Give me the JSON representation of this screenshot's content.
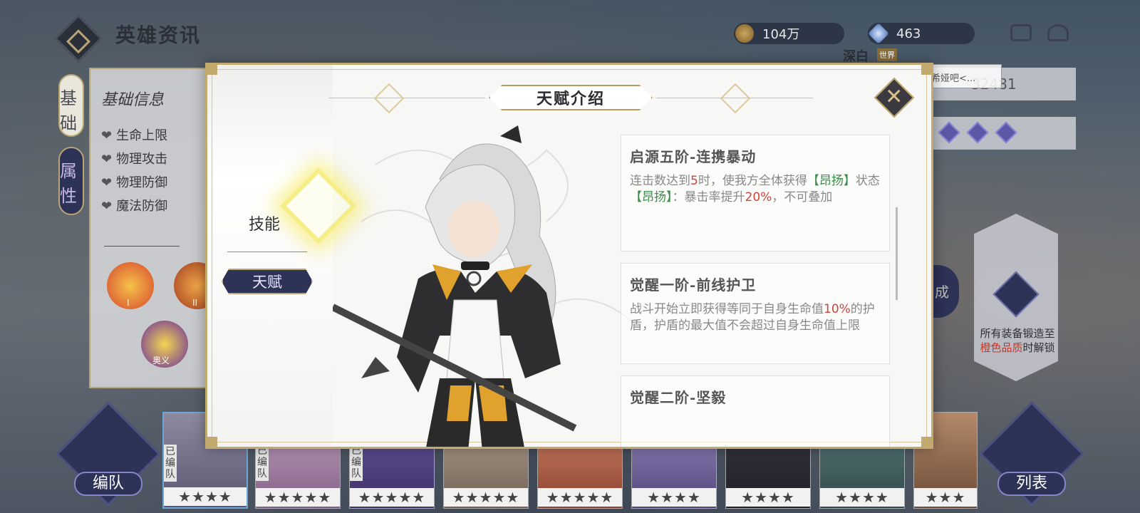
{
  "header": {
    "title": "英雄资讯",
    "gold": "104万",
    "gems": "463"
  },
  "chat": {
    "user": "深白",
    "channel": "世界",
    "message": "希娅吧<..."
  },
  "hero_id": "32481",
  "left_panel": {
    "tab_basic": "基础",
    "tab_attr": "属性",
    "heading": "基础信息",
    "stats": [
      "生命上限",
      "物理攻击",
      "物理防御",
      "魔法防御"
    ],
    "skill_labels": [
      "I",
      "II",
      "奥义"
    ]
  },
  "modal": {
    "title": "天赋介绍",
    "tab_skill": "技能",
    "tab_talent": "天赋",
    "talents": [
      {
        "name": "启源五阶-连携暴动",
        "desc_a": "连击数达到",
        "num_a": "5",
        "desc_b": "时，使我方全体获得",
        "buff_a": "【昂扬】",
        "desc_c": "状态",
        "buff_b": "【昂扬】",
        "desc_d": "：暴击率提升",
        "num_b": "20%",
        "desc_e": "，不可叠加"
      },
      {
        "name": "觉醒一阶-前线护卫",
        "desc_a": "战斗开始立即获得等同于自身生命值",
        "num_a": "10%",
        "desc_b": "的护盾，护盾的最大值不会超过自身生命值上限"
      },
      {
        "name": "觉醒二阶-坚毅",
        "desc_a": "",
        "num_a": ""
      }
    ]
  },
  "locked": {
    "text_a": "所有装备锻造至",
    "text_hl": "橙色品质",
    "text_b": "时解锁",
    "side_badge": "成"
  },
  "nav": {
    "team": "编队",
    "list": "列表"
  },
  "roster": [
    {
      "stars": "★★★★",
      "assigned": "已编队"
    },
    {
      "stars": "★★★★★",
      "assigned": "已编队"
    },
    {
      "stars": "★★★★★",
      "assigned": "已编队"
    },
    {
      "stars": "★★★★★",
      "assigned": ""
    },
    {
      "stars": "★★★★★",
      "assigned": ""
    },
    {
      "stars": "★★★★",
      "assigned": ""
    },
    {
      "stars": "★★★★",
      "assigned": ""
    },
    {
      "stars": "★★★★",
      "assigned": ""
    },
    {
      "stars": "★★★",
      "assigned": ""
    }
  ],
  "colors": {
    "accent_gold": "#c2a96e",
    "navy": "#2d3257",
    "highlight_red": "#d0423a",
    "highlight_green": "#3a8a4a"
  }
}
